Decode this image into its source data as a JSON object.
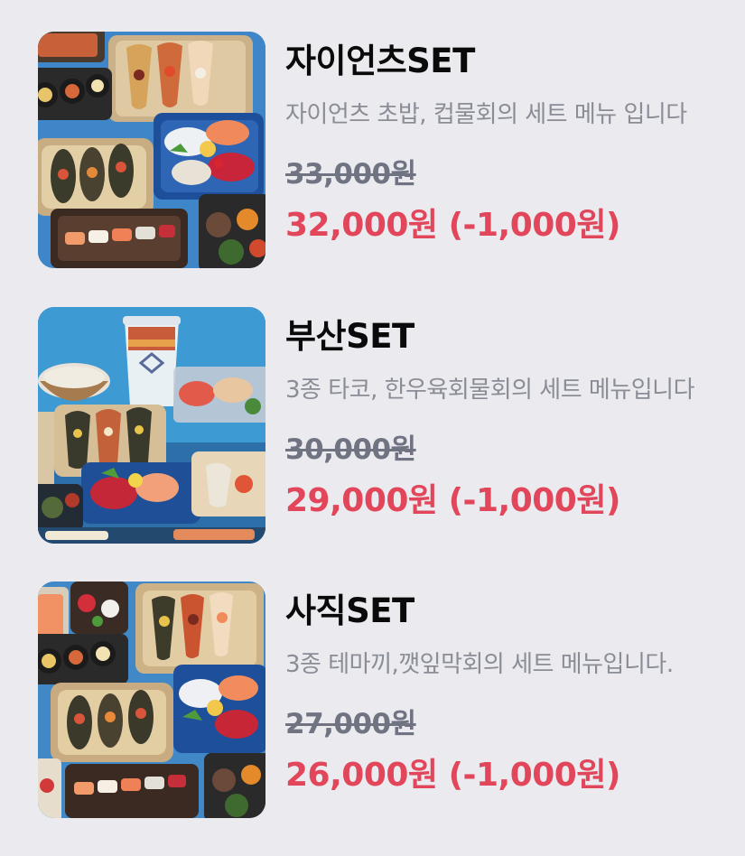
{
  "accent_color": "#e2465a",
  "muted_color": "#6f7382",
  "items": [
    {
      "name": "자이언츠SET",
      "description": "자이언츠 초밥, 컵물회의 세트 메뉴 입니다",
      "original_price": "33,000원",
      "sale_price": "32,000원",
      "discount": "(-1,000원)",
      "image_icon": "sushi-sashimi-platter-photo"
    },
    {
      "name": "부산SET",
      "description": "3종 타코, 한우육회물회의 세트 메뉴입니다",
      "original_price": "30,000원",
      "sale_price": "29,000원",
      "discount": "(-1,000원)",
      "image_icon": "taco-mulhoe-set-photo"
    },
    {
      "name": "사직SET",
      "description": "3종 테마끼,깻잎막회의 세트 메뉴입니다.",
      "original_price": "27,000원",
      "sale_price": "26,000원",
      "discount": "(-1,000원)",
      "image_icon": "temaki-makhoe-set-photo"
    }
  ]
}
